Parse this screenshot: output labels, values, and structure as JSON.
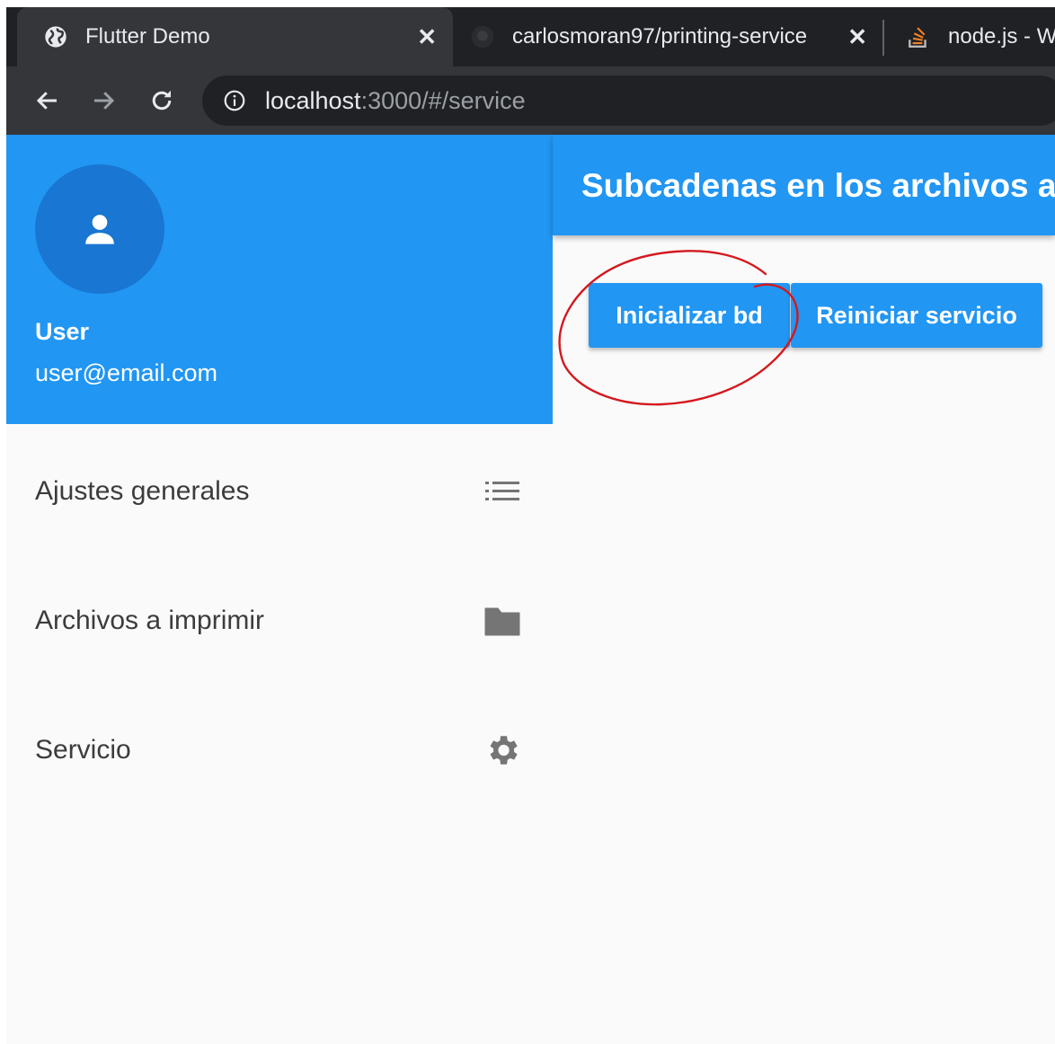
{
  "browser": {
    "tabs": [
      {
        "title": "Flutter Demo",
        "icon": "globe-icon",
        "active": true
      },
      {
        "title": "carlosmoran97/printing-service",
        "icon": "github-icon",
        "active": false
      },
      {
        "title": "node.js - W",
        "icon": "stackoverflow-icon",
        "active": false
      }
    ],
    "address": {
      "host": "localhost",
      "path": ":3000/#/service"
    }
  },
  "drawer": {
    "account": {
      "name": "User",
      "email": "user@email.com"
    },
    "items": [
      {
        "label": "Ajustes generales",
        "icon": "list-icon"
      },
      {
        "label": "Archivos a imprimir",
        "icon": "folder-icon"
      },
      {
        "label": "Servicio",
        "icon": "settings-gear-icon"
      }
    ]
  },
  "main": {
    "title": "Subcadenas en los archivos a",
    "buttons": {
      "init_db": "Inicializar bd",
      "restart_service": "Reiniciar servicio"
    }
  },
  "colors": {
    "primary": "#2196f3",
    "avatar": "#1976d2",
    "annotation": "#d4181e",
    "chrome_dark": "#202124",
    "chrome_tab": "#35363a"
  }
}
